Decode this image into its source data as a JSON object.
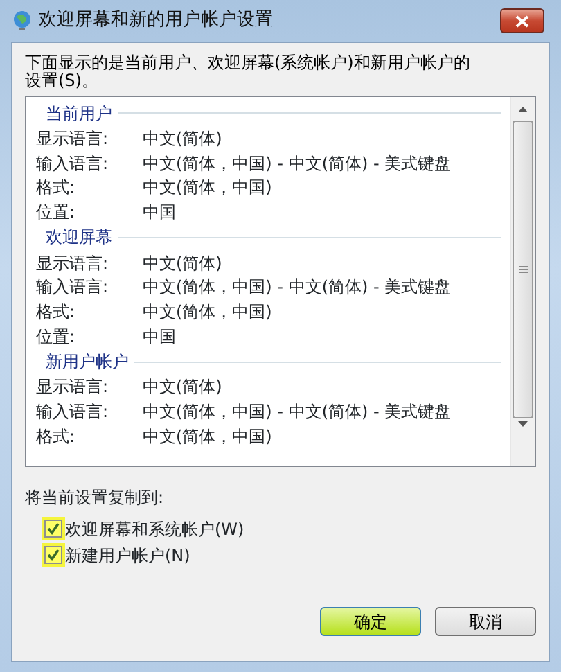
{
  "window": {
    "title": "欢迎屏幕和新的用户帐户设置"
  },
  "intro": "下面显示的是当前用户、欢迎屏幕(系统帐户)和新用户帐户的设置(S)。",
  "sections": [
    {
      "title": "当前用户",
      "rows": [
        {
          "label": "显示语言:",
          "value": "中文(简体)"
        },
        {
          "label": "输入语言:",
          "value": "中文(简体，中国) - 中文(简体) - 美式键盘"
        },
        {
          "label": "格式:",
          "value": "中文(简体，中国)"
        },
        {
          "label": "位置:",
          "value": "中国"
        }
      ]
    },
    {
      "title": "欢迎屏幕",
      "rows": [
        {
          "label": "显示语言:",
          "value": "中文(简体)"
        },
        {
          "label": "输入语言:",
          "value": "中文(简体，中国) - 中文(简体) - 美式键盘"
        },
        {
          "label": "格式:",
          "value": "中文(简体，中国)"
        },
        {
          "label": "位置:",
          "value": "中国"
        }
      ]
    },
    {
      "title": "新用户帐户",
      "rows": [
        {
          "label": "显示语言:",
          "value": "中文(简体)"
        },
        {
          "label": "输入语言:",
          "value": "中文(简体，中国) - 中文(简体) - 美式键盘"
        },
        {
          "label": "格式:",
          "value": "中文(简体，中国)"
        }
      ]
    }
  ],
  "copy_label": "将当前设置复制到:",
  "checkboxes": [
    {
      "label": "欢迎屏幕和系统帐户(W)",
      "checked": true
    },
    {
      "label": "新建用户帐户(N)",
      "checked": true
    }
  ],
  "buttons": [
    {
      "label": "确定",
      "selected": true
    },
    {
      "label": "取消",
      "selected": false
    }
  ]
}
